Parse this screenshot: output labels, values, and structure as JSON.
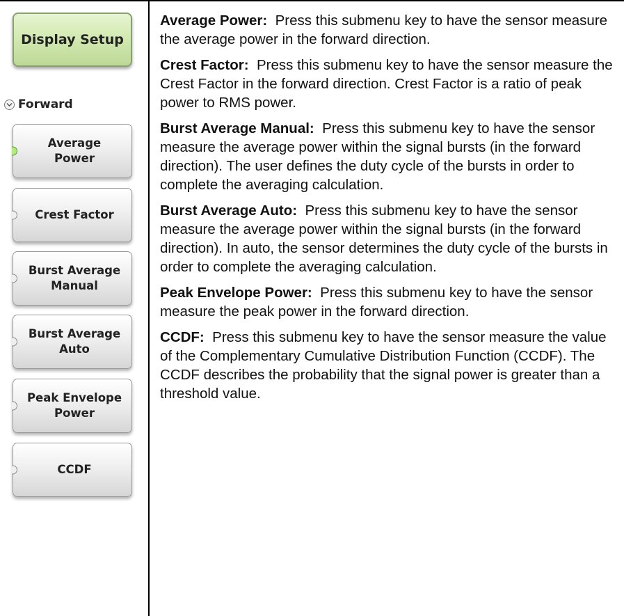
{
  "header": {
    "label": "Display Setup"
  },
  "group": {
    "label": "Forward",
    "icon": "chevron-down-icon"
  },
  "keys": [
    {
      "label": "Average\nPower",
      "active": true
    },
    {
      "label": "Crest Factor",
      "active": false
    },
    {
      "label": "Burst Average\nManual",
      "active": false
    },
    {
      "label": "Burst Average\nAuto",
      "active": false
    },
    {
      "label": "Peak Envelope\nPower",
      "active": false
    },
    {
      "label": "CCDF",
      "active": false
    }
  ],
  "descriptions": [
    {
      "term": "Average Power:",
      "text": "Press this submenu key to have the sensor measure the average power in the forward direction."
    },
    {
      "term": "Crest Factor:",
      "text": "Press this submenu key to have the sensor measure the Crest Factor in the forward direction. Crest Factor is a ratio of peak power to RMS power."
    },
    {
      "term": "Burst Average Manual:",
      "text": "Press this submenu key to have the sensor measure the average power within the signal bursts (in the forward direction). The user defines the duty cycle of the bursts in order to complete the averaging calculation."
    },
    {
      "term": "Burst Average Auto:",
      "text": "Press this submenu key to have the sensor measure the average power within the signal bursts (in the forward direction). In auto, the sensor determines the duty cycle of the bursts in order to complete the averaging calculation."
    },
    {
      "term": "Peak Envelope Power:",
      "text": "Press this submenu key to have the sensor measure the peak power in the forward direction."
    },
    {
      "term": "CCDF:",
      "text": "Press this submenu key to have the sensor measure the value of the Complementary Cumulative Distribution Function (CCDF). The CCDF describes the probability that the signal power is greater than a threshold value."
    }
  ],
  "colors": {
    "header_green": "#d3eab2",
    "led_active": "#b6ea7e",
    "key_gray": "#d6d6d6"
  }
}
